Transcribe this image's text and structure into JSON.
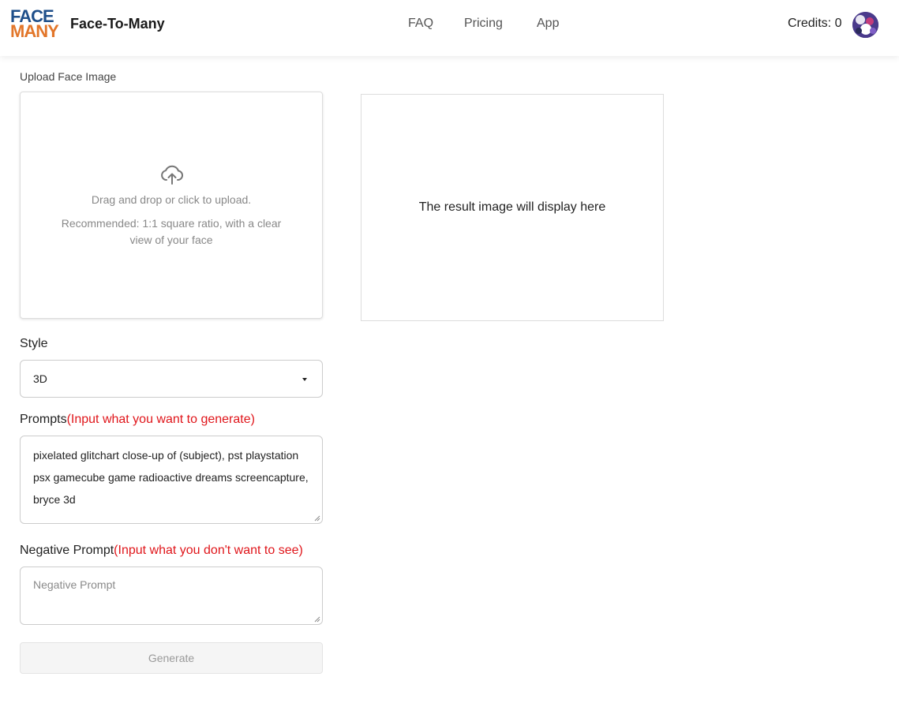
{
  "header": {
    "logo_line1": "FACE",
    "logo_line2": "MANY",
    "brand": "Face-To-Many",
    "nav": [
      "FAQ",
      "Pricing",
      "App"
    ],
    "credits_label": "Credits: 0"
  },
  "upload": {
    "label": "Upload Face Image",
    "instruction": "Drag and drop or click to upload.",
    "recommendation": "Recommended: 1:1 square ratio, with a clear view of your face"
  },
  "result": {
    "placeholder": "The result image will display here"
  },
  "style": {
    "label": "Style",
    "selected": "3D"
  },
  "prompts": {
    "label": "Prompts",
    "hint": "(Input what you want to generate)",
    "value": "pixelated glitchart close-up of (subject), pst playstation psx gamecube game radioactive dreams screencapture, bryce 3d"
  },
  "negative": {
    "label": "Negative Prompt",
    "hint": "(Input what you don't want to see)",
    "placeholder": "Negative Prompt",
    "value": ""
  },
  "generate_label": "Generate",
  "colors": {
    "hint": "#e0161b",
    "logo_blue": "#1f4f8a",
    "logo_orange": "#e2762a"
  }
}
